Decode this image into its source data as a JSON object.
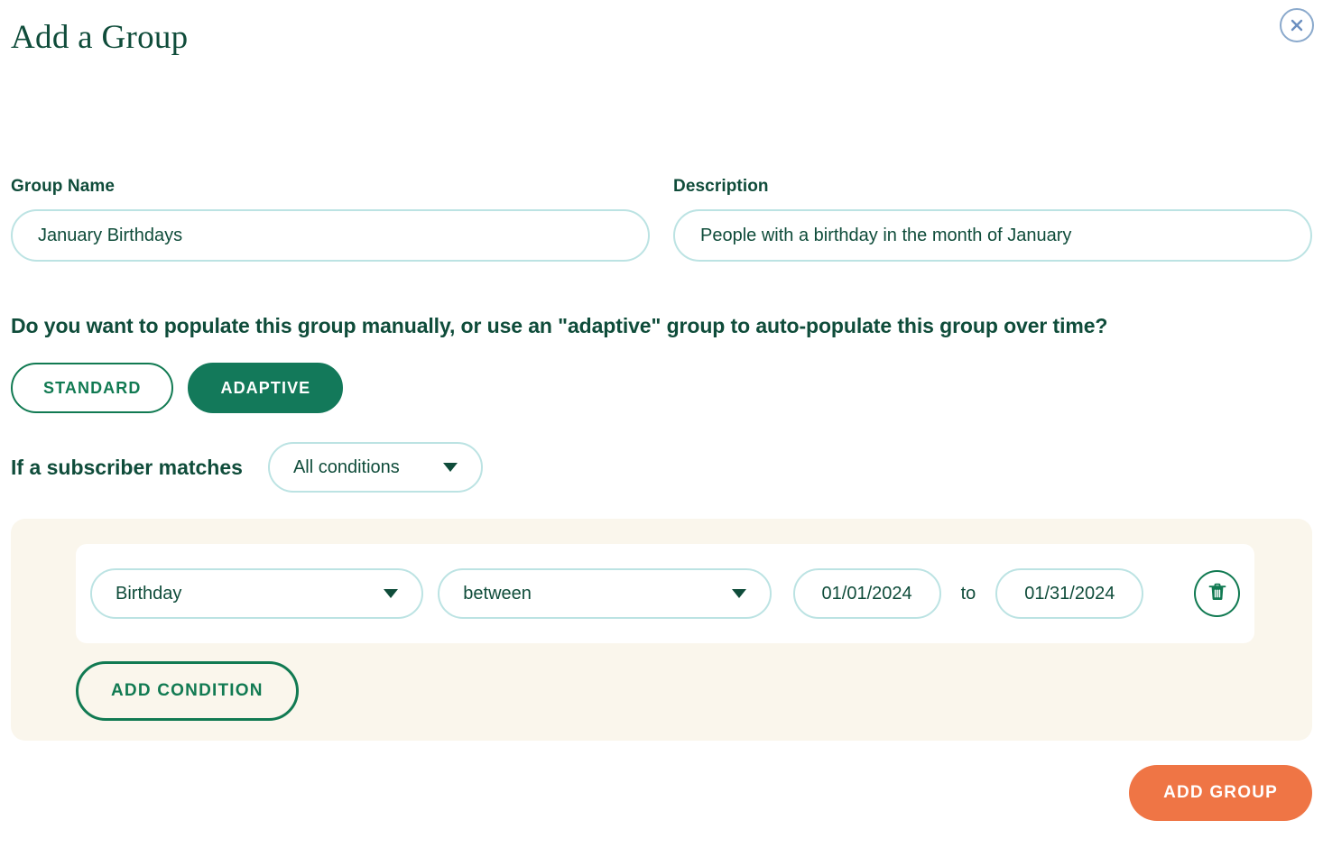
{
  "header": {
    "title": "Add a Group",
    "close_icon": "close-circle-icon"
  },
  "form": {
    "group_name": {
      "label": "Group Name",
      "value": "January Birthdays",
      "placeholder": "Group Name"
    },
    "description": {
      "label": "Description",
      "value": "People with a birthday in the month of January",
      "placeholder": "Description"
    }
  },
  "mode": {
    "question": "Do you want to populate this group manually, or use an \"adaptive\" group to auto-populate this group over time?",
    "standard_label": "STANDARD",
    "adaptive_label": "ADAPTIVE",
    "selected": "ADAPTIVE"
  },
  "match": {
    "label": "If a subscriber matches",
    "selected": "All conditions",
    "caret_icon": "chevron-down-icon"
  },
  "conditions": [
    {
      "field": "Birthday",
      "operator": "between",
      "date_from": "01/01/2024",
      "date_to": "01/31/2024",
      "to_label": "to",
      "delete_icon": "trash-icon"
    }
  ],
  "buttons": {
    "add_condition": "ADD CONDITION",
    "add_group": "ADD GROUP"
  },
  "colors": {
    "brand_green": "#0f4c3a",
    "accent_green": "#13795a",
    "input_border": "#bce3e3",
    "panel_bg": "#faf6ec",
    "cta_orange": "#ef7545",
    "close_blue": "#8aa9cc"
  }
}
